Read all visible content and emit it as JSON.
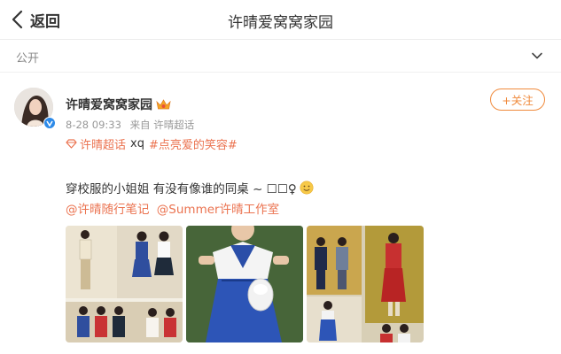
{
  "header": {
    "back_label": "返回",
    "title": "许晴爱窝窝家园"
  },
  "filter": {
    "label": "公开"
  },
  "post": {
    "author": "许晴爱窝窝家园",
    "timestamp": "8-28 09:33",
    "source": "来自 许晴超话",
    "follow_label": "+关注",
    "supertopic": "许晴超话",
    "tag_plain": "xq",
    "hashtag": "#点亮爱的笑容#",
    "text": "穿校服的小姐姐 有没有像谁的同桌 ~ ☐☐♀",
    "mentions": [
      "@许晴随行笔记",
      "@Summer许晴工作室"
    ]
  },
  "colors": {
    "accent": "#eb7350",
    "follow": "#f08a3c",
    "verified": "#2d8ae8"
  },
  "icons": [
    "back-chevron-icon",
    "chevron-down-icon",
    "crown-icon",
    "verified-icon",
    "diamond-icon",
    "smile-icon"
  ]
}
